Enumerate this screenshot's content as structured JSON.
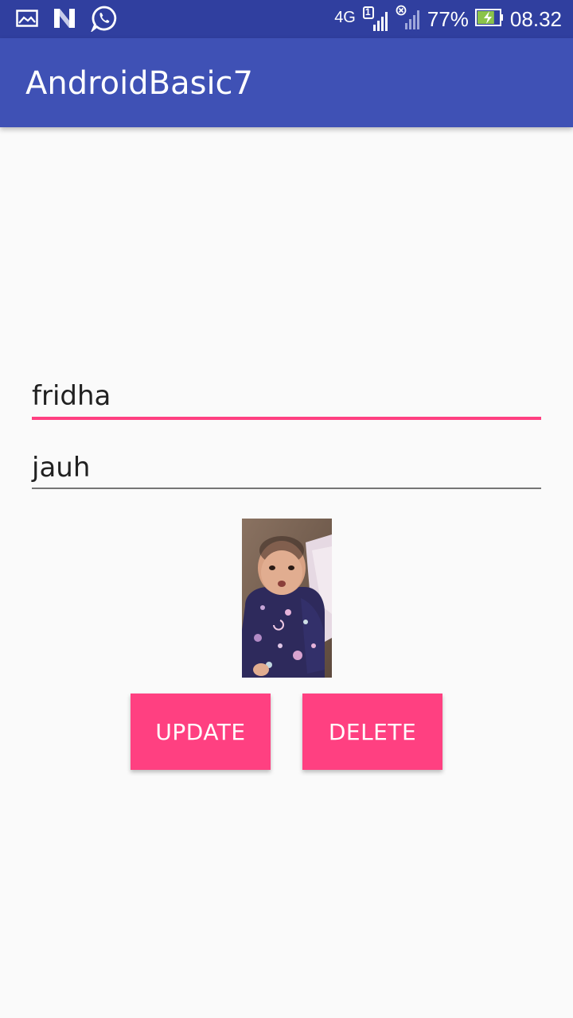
{
  "status_bar": {
    "left_icons": [
      "gallery-icon",
      "n-notification-icon",
      "whatsapp-icon"
    ],
    "network_type": "4G",
    "sim_slot": "1",
    "battery_percent": "77%",
    "battery_level": 0.77,
    "time": "08.32"
  },
  "app_bar": {
    "title": "AndroidBasic7"
  },
  "form": {
    "first_field_value": "fridha",
    "second_field_value": "jauh"
  },
  "buttons": {
    "update_label": "UPDATE",
    "delete_label": "DELETE"
  },
  "colors": {
    "status_bar": "#303f9f",
    "app_bar": "#3f51b5",
    "accent": "#ff4081",
    "background": "#fafafa"
  }
}
